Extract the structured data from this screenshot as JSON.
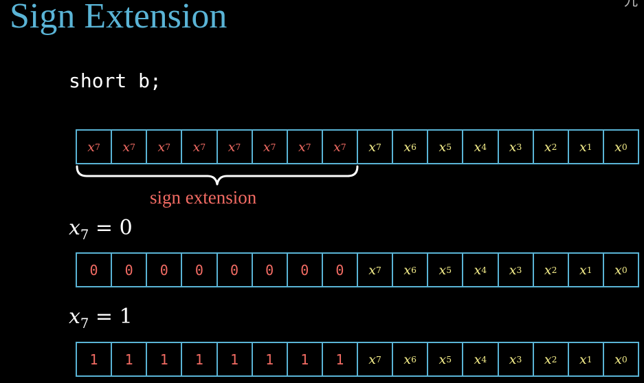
{
  "title": "Sign Extension",
  "corner_text": "九",
  "code": "short b;",
  "colors": {
    "background": "#000000",
    "title": "#5ab4d6",
    "cell_border": "#5ab4d6",
    "extension_bits": "#f26b63",
    "original_bits": "#f5ee8a",
    "code_text": "#ffffff",
    "brace": "#ffffff",
    "sign_label": "#f26b63"
  },
  "sign_extension_label": "sign extension",
  "rows": [
    {
      "cells": [
        {
          "var": "x",
          "sub": "7",
          "kind": "extension"
        },
        {
          "var": "x",
          "sub": "7",
          "kind": "extension"
        },
        {
          "var": "x",
          "sub": "7",
          "kind": "extension"
        },
        {
          "var": "x",
          "sub": "7",
          "kind": "extension"
        },
        {
          "var": "x",
          "sub": "7",
          "kind": "extension"
        },
        {
          "var": "x",
          "sub": "7",
          "kind": "extension"
        },
        {
          "var": "x",
          "sub": "7",
          "kind": "extension"
        },
        {
          "var": "x",
          "sub": "7",
          "kind": "extension"
        },
        {
          "var": "x",
          "sub": "7",
          "kind": "original"
        },
        {
          "var": "x",
          "sub": "6",
          "kind": "original"
        },
        {
          "var": "x",
          "sub": "5",
          "kind": "original"
        },
        {
          "var": "x",
          "sub": "4",
          "kind": "original"
        },
        {
          "var": "x",
          "sub": "3",
          "kind": "original"
        },
        {
          "var": "x",
          "sub": "2",
          "kind": "original"
        },
        {
          "var": "x",
          "sub": "1",
          "kind": "original"
        },
        {
          "var": "x",
          "sub": "0",
          "kind": "original"
        }
      ]
    },
    {
      "condition": {
        "var": "x",
        "sub": "7",
        "rhs": "= 0"
      },
      "cells": [
        {
          "digit": "0",
          "kind": "extension"
        },
        {
          "digit": "0",
          "kind": "extension"
        },
        {
          "digit": "0",
          "kind": "extension"
        },
        {
          "digit": "0",
          "kind": "extension"
        },
        {
          "digit": "0",
          "kind": "extension"
        },
        {
          "digit": "0",
          "kind": "extension"
        },
        {
          "digit": "0",
          "kind": "extension"
        },
        {
          "digit": "0",
          "kind": "extension"
        },
        {
          "var": "x",
          "sub": "7",
          "kind": "original"
        },
        {
          "var": "x",
          "sub": "6",
          "kind": "original"
        },
        {
          "var": "x",
          "sub": "5",
          "kind": "original"
        },
        {
          "var": "x",
          "sub": "4",
          "kind": "original"
        },
        {
          "var": "x",
          "sub": "3",
          "kind": "original"
        },
        {
          "var": "x",
          "sub": "2",
          "kind": "original"
        },
        {
          "var": "x",
          "sub": "1",
          "kind": "original"
        },
        {
          "var": "x",
          "sub": "0",
          "kind": "original"
        }
      ]
    },
    {
      "condition": {
        "var": "x",
        "sub": "7",
        "rhs": "= 1"
      },
      "cells": [
        {
          "digit": "1",
          "kind": "extension"
        },
        {
          "digit": "1",
          "kind": "extension"
        },
        {
          "digit": "1",
          "kind": "extension"
        },
        {
          "digit": "1",
          "kind": "extension"
        },
        {
          "digit": "1",
          "kind": "extension"
        },
        {
          "digit": "1",
          "kind": "extension"
        },
        {
          "digit": "1",
          "kind": "extension"
        },
        {
          "digit": "1",
          "kind": "extension"
        },
        {
          "var": "x",
          "sub": "7",
          "kind": "original"
        },
        {
          "var": "x",
          "sub": "6",
          "kind": "original"
        },
        {
          "var": "x",
          "sub": "5",
          "kind": "original"
        },
        {
          "var": "x",
          "sub": "4",
          "kind": "original"
        },
        {
          "var": "x",
          "sub": "3",
          "kind": "original"
        },
        {
          "var": "x",
          "sub": "2",
          "kind": "original"
        },
        {
          "var": "x",
          "sub": "1",
          "kind": "original"
        },
        {
          "var": "x",
          "sub": "0",
          "kind": "original"
        }
      ]
    }
  ]
}
